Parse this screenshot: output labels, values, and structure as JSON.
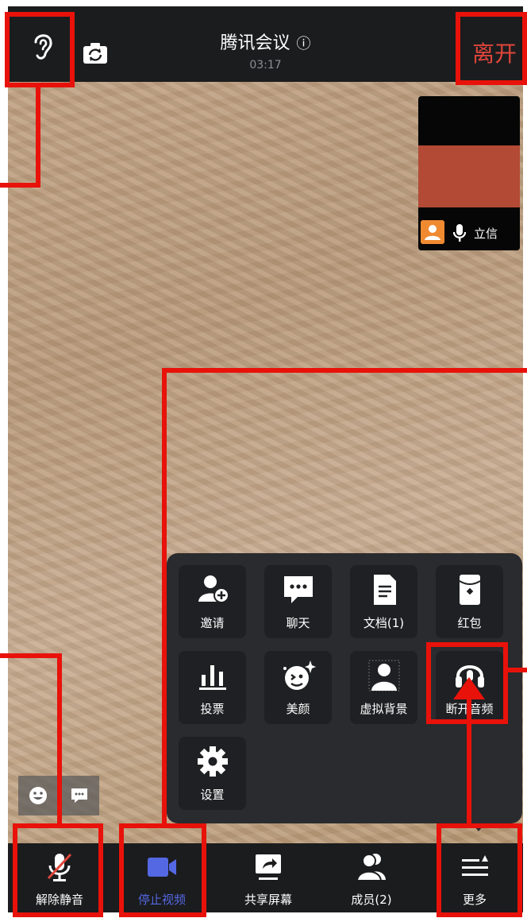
{
  "header": {
    "title": "腾讯会议",
    "timer": "03:17",
    "leave_label": "离开",
    "icons": {
      "ear": "ear-icon",
      "camera_flip": "camera-flip-icon",
      "info": "info-icon"
    }
  },
  "pip": {
    "participant_name": "立信",
    "icons": {
      "avatar": "avatar-icon",
      "mic": "mic-icon"
    }
  },
  "more_menu": {
    "items": [
      {
        "label": "邀请",
        "icon": "invite-icon"
      },
      {
        "label": "聊天",
        "icon": "chat-icon"
      },
      {
        "label": "文档(1)",
        "icon": "document-icon"
      },
      {
        "label": "红包",
        "icon": "red-packet-icon"
      },
      {
        "label": "投票",
        "icon": "vote-icon"
      },
      {
        "label": "美颜",
        "icon": "beauty-icon"
      },
      {
        "label": "虚拟背景",
        "icon": "virtual-background-icon"
      },
      {
        "label": "断开音频",
        "icon": "headphones-icon"
      },
      {
        "label": "设置",
        "icon": "gear-icon"
      }
    ]
  },
  "quick_actions": {
    "icons": [
      "emoji-icon",
      "message-icon"
    ]
  },
  "toolbar": {
    "items": [
      {
        "label": "解除静音",
        "icon": "mic-muted-icon"
      },
      {
        "label": "停止视频",
        "icon": "video-camera-icon",
        "active": true
      },
      {
        "label": "共享屏幕",
        "icon": "share-screen-icon"
      },
      {
        "label": "成员(2)",
        "icon": "members-icon"
      },
      {
        "label": "更多",
        "icon": "more-menu-icon"
      }
    ]
  },
  "colors": {
    "topbar": "#1b1c1e",
    "leave": "#e0463b",
    "active_toolbar": "#5468e4",
    "highlight": "#e8120a",
    "menu_bg": "#2a2b2e",
    "avatar_orange": "#f08a31"
  }
}
